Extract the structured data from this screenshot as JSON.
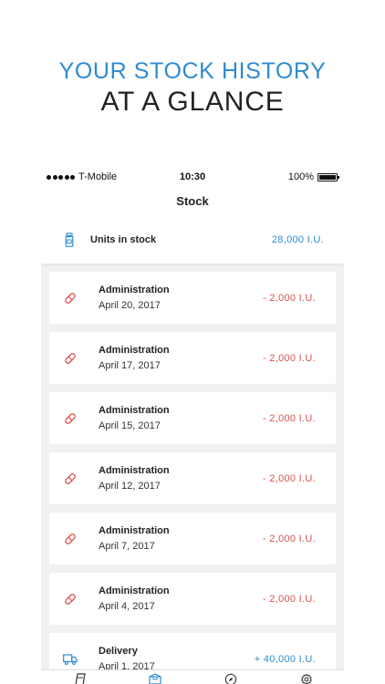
{
  "headline": {
    "line1": "YOUR STOCK HISTORY",
    "line2": "AT A GLANCE"
  },
  "status_bar": {
    "carrier": "T-Mobile",
    "time": "10:30",
    "battery": "100%"
  },
  "nav": {
    "title": "Stock"
  },
  "summary": {
    "icon": "bottle-icon",
    "label": "Units in stock",
    "value": "28,000 I.U."
  },
  "entries": [
    {
      "icon": "pill-icon",
      "title": "Administration",
      "date": "April 20, 2017",
      "amount": "- 2,000 I.U."
    },
    {
      "icon": "pill-icon",
      "title": "Administration",
      "date": "April 17, 2017",
      "amount": "- 2,000 I.U."
    },
    {
      "icon": "pill-icon",
      "title": "Administration",
      "date": "April 15, 2017",
      "amount": "- 2,000 I.U."
    },
    {
      "icon": "pill-icon",
      "title": "Administration",
      "date": "April 12, 2017",
      "amount": "- 2,000 I.U."
    },
    {
      "icon": "pill-icon",
      "title": "Administration",
      "date": "April 7, 2017",
      "amount": "- 2,000 I.U."
    },
    {
      "icon": "pill-icon",
      "title": "Administration",
      "date": "April 4, 2017",
      "amount": "- 2,000 I.U."
    },
    {
      "icon": "truck-icon",
      "title": "Delivery",
      "date": "April 1, 2017",
      "amount": "+ 40,000 I.U."
    }
  ],
  "tabs": [
    {
      "icon": "log-icon"
    },
    {
      "icon": "stock-icon"
    },
    {
      "icon": "compass-icon"
    },
    {
      "icon": "gear-icon"
    }
  ],
  "colors": {
    "accent": "#2d8bd1",
    "negative": "#d9534f",
    "background": "#f1f1f1"
  }
}
